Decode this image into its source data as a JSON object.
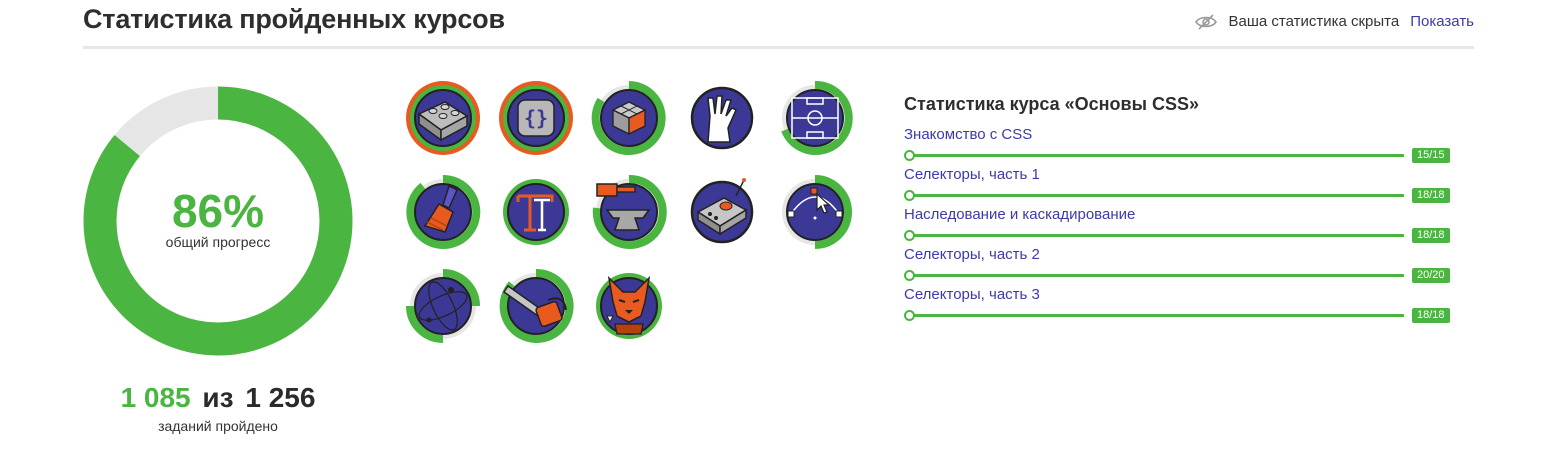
{
  "header": {
    "title": "Статистика пройденных курсов",
    "privacy_text": "Ваша статистика скрыта",
    "show_label": "Показать",
    "icons": {
      "privacy": "eye-hidden-icon"
    }
  },
  "progress": {
    "percent_label": "86%",
    "percent_value": 0.86,
    "caption": "общий прогресс",
    "tasks_done": "1 085",
    "tasks_sep": "из",
    "tasks_total": "1 256",
    "tasks_caption": "заданий пройдено"
  },
  "badges": [
    {
      "icon": "lego-brick-icon",
      "ring": "orange"
    },
    {
      "icon": "curly-braces-icon",
      "ring": "orange"
    },
    {
      "icon": "cube-blocks-icon",
      "ring": "green-partial",
      "progress": 0.78
    },
    {
      "icon": "vulcan-hand-icon",
      "ring": "none"
    },
    {
      "icon": "football-field-icon",
      "ring": "green-partial",
      "progress": 0.66
    },
    {
      "icon": "paint-brush-icon",
      "ring": "green-partial",
      "progress": 0.85
    },
    {
      "icon": "typography-t-icon",
      "ring": "green"
    },
    {
      "icon": "anvil-hammer-icon",
      "ring": "green-partial",
      "progress": 0.72
    },
    {
      "icon": "control-box-icon",
      "ring": "none"
    },
    {
      "icon": "vector-cursor-icon",
      "ring": "green-partial",
      "progress": 0.5
    },
    {
      "icon": "globe-orbit-icon",
      "ring": "green-partial",
      "progress": 0.3
    },
    {
      "icon": "chainsaw-icon",
      "ring": "green-partial",
      "progress": 0.8
    },
    {
      "icon": "fox-cat-icon",
      "ring": "green"
    }
  ],
  "course": {
    "title": "Статистика курса «Основы CSS»",
    "lessons": [
      {
        "label": "Знакомство с CSS",
        "score": "15/15",
        "fraction": 1.0
      },
      {
        "label": "Селекторы, часть 1",
        "score": "18/18",
        "fraction": 1.0
      },
      {
        "label": "Наследование и каскадирование",
        "score": "18/18",
        "fraction": 1.0
      },
      {
        "label": "Селекторы, часть 2",
        "score": "20/20",
        "fraction": 1.0
      },
      {
        "label": "Селекторы, часть 3",
        "score": "18/18",
        "fraction": 1.0
      }
    ]
  },
  "colors": {
    "green": "#4ab540",
    "orange": "#e85a1f",
    "navy": "#3b3896",
    "link": "#3d3aa9",
    "track": "#e6e6e6"
  }
}
